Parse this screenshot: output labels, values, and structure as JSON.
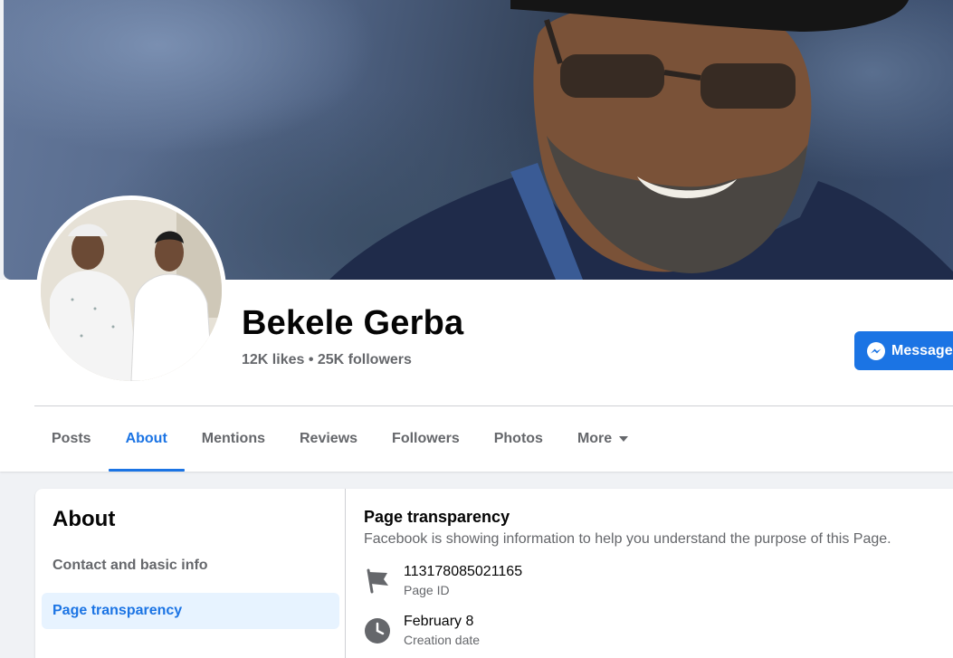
{
  "profile": {
    "name": "Bekele Gerba",
    "stats": "12K likes • 25K followers",
    "message_label": "Message"
  },
  "tabs": [
    {
      "label": "Posts",
      "active": false
    },
    {
      "label": "About",
      "active": true
    },
    {
      "label": "Mentions",
      "active": false
    },
    {
      "label": "Reviews",
      "active": false
    },
    {
      "label": "Followers",
      "active": false
    },
    {
      "label": "Photos",
      "active": false
    },
    {
      "label": "More",
      "active": false
    }
  ],
  "about": {
    "title": "About",
    "items": [
      {
        "label": "Contact and basic info",
        "active": false
      },
      {
        "label": "Page transparency",
        "active": true
      }
    ]
  },
  "transparency": {
    "title": "Page transparency",
    "description": "Facebook is showing information to help you understand the purpose of this Page.",
    "rows": [
      {
        "value": "113178085021165",
        "label": "Page ID",
        "icon": "flag-icon"
      },
      {
        "value": "February 8",
        "label": "Creation date",
        "icon": "clock-icon"
      }
    ]
  },
  "colors": {
    "accent": "#1b74e4",
    "accent_bg": "#e7f3ff",
    "secondary_text": "#65676b",
    "page_bg": "#f0f2f5"
  }
}
